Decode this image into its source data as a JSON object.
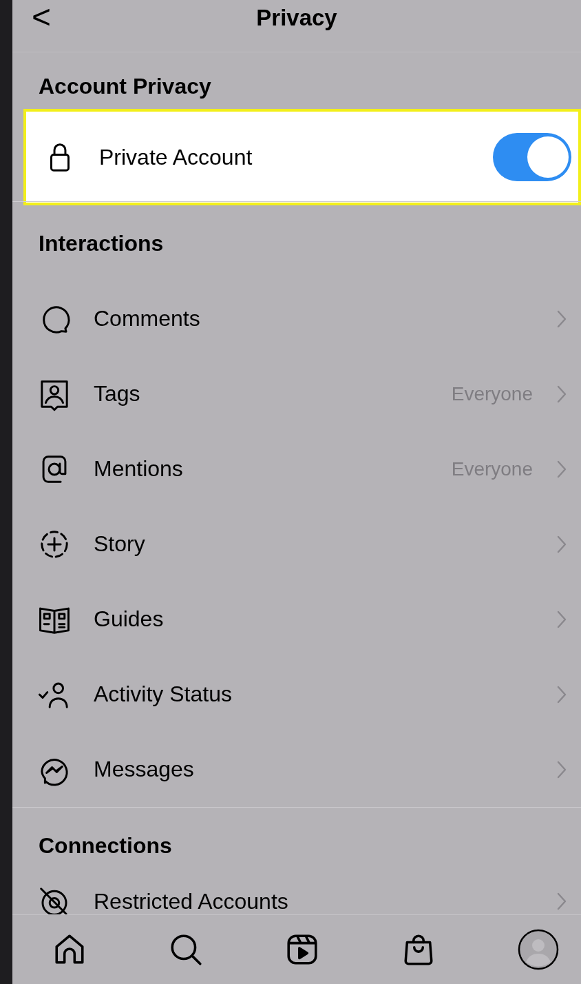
{
  "header": {
    "back": "<",
    "title": "Privacy"
  },
  "sections": [
    {
      "title": "Account Privacy",
      "items": [
        {
          "kind": "toggle",
          "label": "Private Account",
          "on": true,
          "highlighted": true
        }
      ]
    },
    {
      "title": "Interactions",
      "items": [
        {
          "kind": "link",
          "label": "Comments",
          "highlighted": false
        },
        {
          "kind": "link",
          "label": "Tags",
          "value": "Everyone",
          "highlighted": false
        },
        {
          "kind": "link",
          "label": "Mentions",
          "value": "Everyone",
          "highlighted": false
        },
        {
          "kind": "link",
          "label": "Story",
          "highlighted": false
        },
        {
          "kind": "link",
          "label": "Guides",
          "highlighted": false
        },
        {
          "kind": "link",
          "label": "Activity Status",
          "highlighted": false
        },
        {
          "kind": "link",
          "label": "Messages",
          "highlighted": false
        }
      ]
    },
    {
      "title": "Connections",
      "items": [
        {
          "kind": "link",
          "label": "Restricted Accounts",
          "highlighted": false
        }
      ]
    }
  ]
}
